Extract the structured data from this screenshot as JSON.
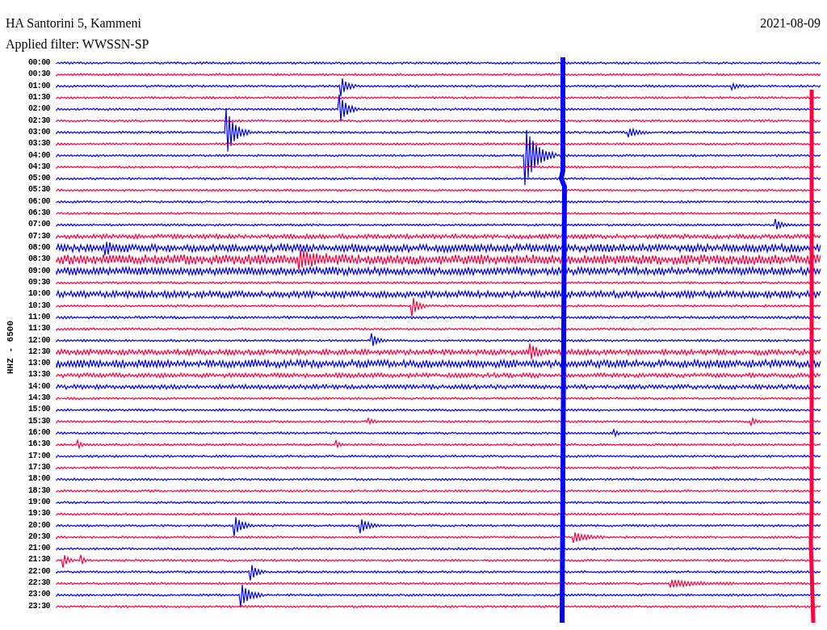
{
  "header": {
    "title": "HA Santorini 5, Kammeni",
    "date": "2021-08-09",
    "filter": "Applied filter: WWSSN-SP"
  },
  "channel_label": "HHZ - 6500",
  "rows": [
    {
      "time": "00:00"
    },
    {
      "time": "00:30"
    },
    {
      "time": "01:00"
    },
    {
      "time": "01:30"
    },
    {
      "time": "02:00"
    },
    {
      "time": "02:30"
    },
    {
      "time": "03:00"
    },
    {
      "time": "03:30"
    },
    {
      "time": "04:00"
    },
    {
      "time": "04:30"
    },
    {
      "time": "05:00"
    },
    {
      "time": "05:30"
    },
    {
      "time": "06:00"
    },
    {
      "time": "06:30"
    },
    {
      "time": "07:00"
    },
    {
      "time": "07:30"
    },
    {
      "time": "08:00"
    },
    {
      "time": "08:30"
    },
    {
      "time": "09:00"
    },
    {
      "time": "09:30"
    },
    {
      "time": "10:00"
    },
    {
      "time": "10:30"
    },
    {
      "time": "11:00"
    },
    {
      "time": "11:30"
    },
    {
      "time": "12:00"
    },
    {
      "time": "12:30"
    },
    {
      "time": "13:00"
    },
    {
      "time": "13:30"
    },
    {
      "time": "14:00"
    },
    {
      "time": "14:30"
    },
    {
      "time": "15:00"
    },
    {
      "time": "15:30"
    },
    {
      "time": "16:00"
    },
    {
      "time": "16:30"
    },
    {
      "time": "17:00"
    },
    {
      "time": "17:30"
    },
    {
      "time": "18:00"
    },
    {
      "time": "18:30"
    },
    {
      "time": "19:00"
    },
    {
      "time": "19:30"
    },
    {
      "time": "20:00"
    },
    {
      "time": "20:30"
    },
    {
      "time": "21:00"
    },
    {
      "time": "21:30"
    },
    {
      "time": "22:00"
    },
    {
      "time": "22:30"
    },
    {
      "time": "23:00"
    },
    {
      "time": "23:30"
    }
  ]
}
